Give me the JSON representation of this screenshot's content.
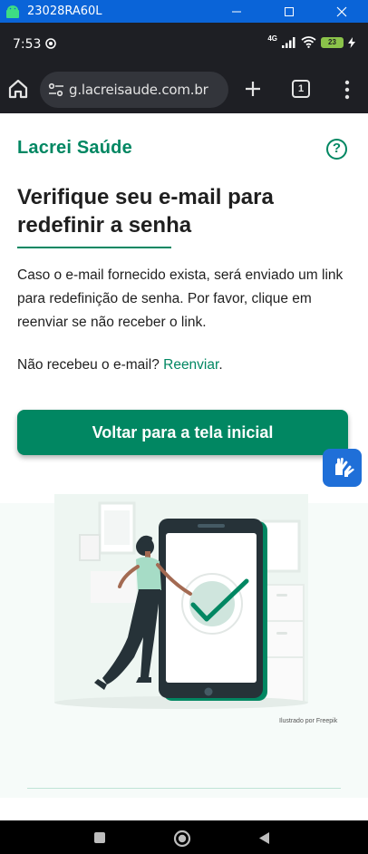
{
  "window": {
    "title": "23028RA60L"
  },
  "statusbar": {
    "time": "7:53",
    "network": "4G",
    "battery": "23"
  },
  "browser": {
    "url": "g.lacreisaude.com.br",
    "tab_count": "1"
  },
  "page": {
    "brand": "Lacrei Saúde",
    "help_label": "?",
    "heading": "Verifique seu e-mail para redefinir a senha",
    "description": "Caso o e-mail fornecido exista, será enviado um link para redefinição de senha. Por favor, clique em reenviar se não receber o link.",
    "resend_prompt": "Não recebeu o e-mail?",
    "resend_link": "Reenviar",
    "resend_period": ".",
    "back_button": "Voltar para a tela inicial",
    "illustration_credit": "Ilustrado por Freepik"
  },
  "colors": {
    "brand": "#018762",
    "winbar": "#0a64d8",
    "vlibras": "#1f6fd8"
  },
  "icons": [
    "android-icon",
    "minimize-icon",
    "maximize-icon",
    "close-icon",
    "notification-icon",
    "signal-icon",
    "wifi-icon",
    "battery-icon",
    "home-icon",
    "site-settings-icon",
    "new-tab-icon",
    "tab-switcher-icon",
    "more-menu-icon",
    "help-icon",
    "sign-language-icon",
    "recent-apps-icon",
    "home-nav-icon",
    "back-icon"
  ]
}
